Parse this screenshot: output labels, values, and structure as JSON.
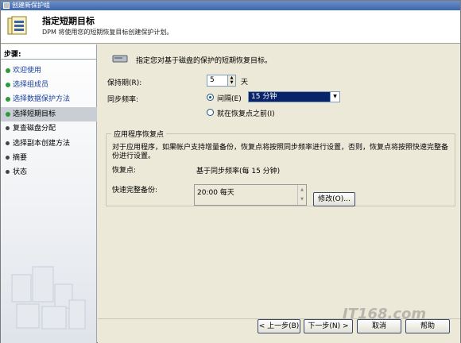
{
  "window": {
    "title": "创建新保护组"
  },
  "header": {
    "title": "指定短期目标",
    "description": "DPM 将使用您的短期恢复目标创建保护计划。"
  },
  "sidebar": {
    "title": "步骤:",
    "items": [
      {
        "label": "欢迎使用",
        "state": "done"
      },
      {
        "label": "选择组成员",
        "state": "done"
      },
      {
        "label": "选择数据保护方法",
        "state": "done"
      },
      {
        "label": "选择短期目标",
        "state": "current"
      },
      {
        "label": "复查磁盘分配",
        "state": "pending"
      },
      {
        "label": "选择副本创建方法",
        "state": "pending"
      },
      {
        "label": "摘要",
        "state": "pending"
      },
      {
        "label": "状态",
        "state": "pending"
      }
    ]
  },
  "main": {
    "intro": "指定您对基于磁盘的保护的短期恢复目标。",
    "retention_label": "保持期(R):",
    "retention_value": "5",
    "retention_unit": "天",
    "sync_label": "同步频率:",
    "interval_label": "间隔(E)",
    "interval_value": "15 分钟",
    "before_recovery_label": "就在恢复点之前(I)",
    "app_group": {
      "legend": "应用程序恢复点",
      "description": "对于应用程序，如果帐户支持增量备份，恢复点将按照同步频率进行设置，否则，恢复点将按照快速完整备份进行设置。",
      "recovery_label": "恢复点:",
      "recovery_value": "基于同步频率(每 15 分钟)",
      "full_backup_label": "快速完整备份:",
      "full_backup_value": "20:00 每天",
      "modify_button": "修改(O)..."
    }
  },
  "footer": {
    "back": "< 上一步(B)",
    "next": "下一步(N) >",
    "cancel": "取消",
    "help": "帮助"
  },
  "watermark": "IT168.com"
}
